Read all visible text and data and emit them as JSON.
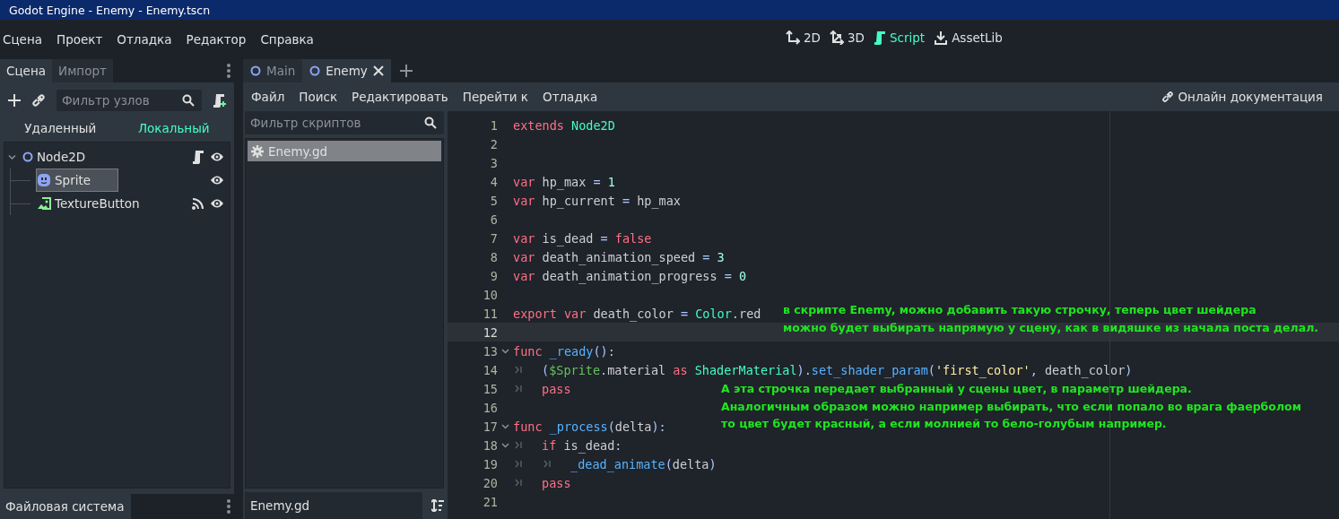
{
  "window": {
    "title": "Godot Engine - Enemy - Enemy.tscn"
  },
  "menu": [
    "Сцена",
    "Проект",
    "Отладка",
    "Редактор",
    "Справка"
  ],
  "workspaces": [
    {
      "label": "2D",
      "kind": "plane",
      "selected": false
    },
    {
      "label": "3D",
      "kind": "volume",
      "selected": false
    },
    {
      "label": "Script",
      "kind": "script",
      "selected": true
    },
    {
      "label": "AssetLib",
      "kind": "assetlib",
      "selected": false
    }
  ],
  "left_dock": {
    "tabs": [
      {
        "label": "Сцена",
        "selected": true
      },
      {
        "label": "Импорт",
        "selected": false
      }
    ],
    "filter": {
      "placeholder": "Фильтр узлов"
    },
    "modes": [
      {
        "label": "Удаленный",
        "selected": false
      },
      {
        "label": "Локальный",
        "selected": true
      }
    ],
    "tree": [
      {
        "name": "Node2D",
        "kind": "node2d",
        "expanded": true,
        "selected": false,
        "script": true,
        "signal": false,
        "children": [
          {
            "name": "Sprite",
            "kind": "sprite",
            "selected": true,
            "script": false,
            "signal": false
          },
          {
            "name": "TextureButton",
            "kind": "texturebutton",
            "selected": false,
            "script": false,
            "signal": true
          }
        ]
      }
    ],
    "bottom_tab": "Файловая система"
  },
  "scene_tabs": [
    {
      "label": "Main",
      "selected": false
    },
    {
      "label": "Enemy",
      "selected": true
    }
  ],
  "script_menu": [
    "Файл",
    "Поиск",
    "Редактировать",
    "Перейти к",
    "Отладка"
  ],
  "online_docs": "Онлайн документация",
  "script_list": {
    "filter": {
      "placeholder": "Фильтр скриптов"
    },
    "items": [
      {
        "name": "Enemy.gd",
        "selected": true
      }
    ],
    "current": "Enemy.gd"
  },
  "code": [
    {
      "number": "1",
      "foldable": false,
      "current": false,
      "tokens": [
        {
          "kind": "kw",
          "text": "extends "
        },
        {
          "kind": "type",
          "text": "Node2D"
        }
      ]
    },
    {
      "number": "2",
      "foldable": false,
      "current": false
    },
    {
      "number": "3",
      "foldable": false,
      "current": false
    },
    {
      "number": "4",
      "foldable": false,
      "current": false,
      "tokens": [
        {
          "kind": "kw",
          "text": "var "
        },
        {
          "kind": "plain",
          "text": "hp_max "
        },
        {
          "kind": "sym",
          "text": "= "
        },
        {
          "kind": "num",
          "text": "1"
        }
      ]
    },
    {
      "number": "5",
      "foldable": false,
      "current": false,
      "tokens": [
        {
          "kind": "kw",
          "text": "var "
        },
        {
          "kind": "plain",
          "text": "hp_current "
        },
        {
          "kind": "sym",
          "text": "= "
        },
        {
          "kind": "plain",
          "text": "hp_max"
        }
      ]
    },
    {
      "number": "6",
      "foldable": false,
      "current": false
    },
    {
      "number": "7",
      "foldable": false,
      "current": false,
      "tokens": [
        {
          "kind": "kw",
          "text": "var "
        },
        {
          "kind": "plain",
          "text": "is_dead "
        },
        {
          "kind": "sym",
          "text": "= "
        },
        {
          "kind": "kw",
          "text": "false"
        }
      ]
    },
    {
      "number": "8",
      "foldable": false,
      "current": false,
      "tokens": [
        {
          "kind": "kw",
          "text": "var "
        },
        {
          "kind": "plain",
          "text": "death_animation_speed "
        },
        {
          "kind": "sym",
          "text": "= "
        },
        {
          "kind": "num",
          "text": "3"
        }
      ]
    },
    {
      "number": "9",
      "foldable": false,
      "current": false,
      "tokens": [
        {
          "kind": "kw",
          "text": "var "
        },
        {
          "kind": "plain",
          "text": "death_animation_progress "
        },
        {
          "kind": "sym",
          "text": "= "
        },
        {
          "kind": "num",
          "text": "0"
        }
      ]
    },
    {
      "number": "10",
      "foldable": false,
      "current": false
    },
    {
      "number": "11",
      "foldable": false,
      "current": false,
      "tokens": [
        {
          "kind": "kw",
          "text": "export var "
        },
        {
          "kind": "plain",
          "text": "death_color "
        },
        {
          "kind": "sym",
          "text": "= "
        },
        {
          "kind": "type",
          "text": "Color"
        },
        {
          "kind": "sym",
          "text": "."
        },
        {
          "kind": "plain",
          "text": "red"
        }
      ]
    },
    {
      "number": "12",
      "foldable": false,
      "current": true
    },
    {
      "number": "13",
      "foldable": true,
      "current": false,
      "tokens": [
        {
          "kind": "kw",
          "text": "func "
        },
        {
          "kind": "fn",
          "text": "_ready"
        },
        {
          "kind": "sym",
          "text": "():"
        }
      ]
    },
    {
      "number": "14",
      "foldable": false,
      "current": false,
      "tokens": [
        {
          "kind": "tab"
        },
        {
          "kind": "sym",
          "text": "("
        },
        {
          "kind": "node",
          "text": "$Sprite"
        },
        {
          "kind": "sym",
          "text": "."
        },
        {
          "kind": "plain",
          "text": "material "
        },
        {
          "kind": "kw",
          "text": "as "
        },
        {
          "kind": "type",
          "text": "ShaderMaterial"
        },
        {
          "kind": "sym",
          "text": ")."
        },
        {
          "kind": "fn",
          "text": "set_shader_param"
        },
        {
          "kind": "sym",
          "text": "("
        },
        {
          "kind": "str",
          "text": "'first_color'"
        },
        {
          "kind": "sym",
          "text": ","
        },
        {
          "kind": "plain",
          "text": " death_color"
        },
        {
          "kind": "sym",
          "text": ")"
        }
      ]
    },
    {
      "number": "15",
      "foldable": false,
      "current": false,
      "tokens": [
        {
          "kind": "tab"
        },
        {
          "kind": "kw",
          "text": "pass"
        }
      ]
    },
    {
      "number": "16",
      "foldable": false,
      "current": false
    },
    {
      "number": "17",
      "foldable": true,
      "current": false,
      "tokens": [
        {
          "kind": "kw",
          "text": "func "
        },
        {
          "kind": "fn",
          "text": "_process"
        },
        {
          "kind": "sym",
          "text": "("
        },
        {
          "kind": "plain",
          "text": "delta"
        },
        {
          "kind": "sym",
          "text": "):"
        }
      ]
    },
    {
      "number": "18",
      "foldable": true,
      "current": false,
      "tokens": [
        {
          "kind": "tab"
        },
        {
          "kind": "kw",
          "text": "if "
        },
        {
          "kind": "plain",
          "text": "is_dead"
        },
        {
          "kind": "sym",
          "text": ":"
        }
      ]
    },
    {
      "number": "19",
      "foldable": false,
      "current": false,
      "tokens": [
        {
          "kind": "tab"
        },
        {
          "kind": "tab"
        },
        {
          "kind": "fn",
          "text": "_dead_animate"
        },
        {
          "kind": "sym",
          "text": "("
        },
        {
          "kind": "plain",
          "text": "delta"
        },
        {
          "kind": "sym",
          "text": ")"
        }
      ]
    },
    {
      "number": "20",
      "foldable": false,
      "current": false,
      "tokens": [
        {
          "kind": "tab"
        },
        {
          "kind": "kw",
          "text": "pass"
        }
      ]
    },
    {
      "number": "21",
      "foldable": false,
      "current": false
    }
  ],
  "annotations": [
    {
      "kind": "upper",
      "lines": [
        "в скрипте Enemy, можно добавить такую строчку, теперь цвет шейдера",
        "можно будет выбирать напрямую у сцену, как в видяшке из начала поста делал."
      ]
    },
    {
      "kind": "lower",
      "lines": [
        "А эта строчка передает выбранный у сцены цвет, в параметр шейдера.",
        "Аналогичным образом можно например выбирать, что если попало во врага фаерболом",
        "то цвет будет красный, а если молнией то бело-голубым например."
      ]
    }
  ]
}
